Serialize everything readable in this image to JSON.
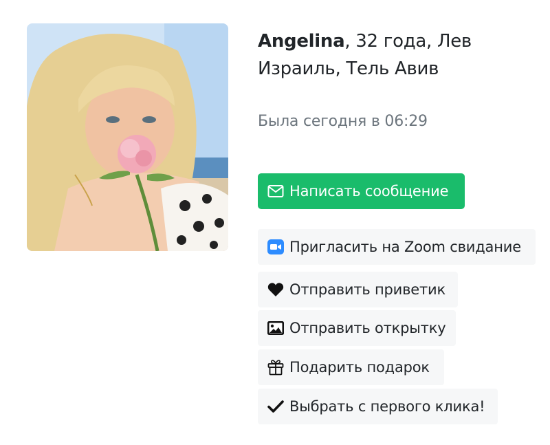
{
  "profile": {
    "name": "Angelina",
    "details": ", 32 года, Лев",
    "location": "Израиль, Тель Авив",
    "last_seen": "Была сегодня в 06:29",
    "photo_icon": "profile-photo"
  },
  "actions": {
    "message": "Написать сообщение",
    "zoom": "Пригласить на Zoom свидание",
    "greeting": "Отправить приветик",
    "postcard": "Отправить открытку",
    "gift": "Подарить подарок",
    "first_click": "Выбрать с первого клика!"
  },
  "icons": {
    "message": "envelope-icon",
    "zoom": "zoom-camera-icon",
    "greeting": "heart-icon",
    "postcard": "image-icon",
    "gift": "gift-icon",
    "first_click": "checkmark-icon"
  },
  "colors": {
    "primary": "#1abc6b",
    "light_button": "#f6f7f8",
    "muted_text": "#6c757d",
    "zoom_blue": "#2d8cff"
  }
}
